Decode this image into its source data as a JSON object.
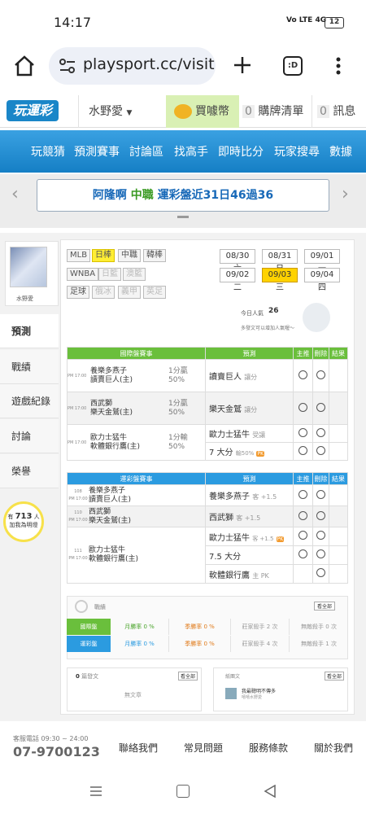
{
  "status": {
    "time": "14:17",
    "network": "Vo LTE 4G",
    "battery": "12"
  },
  "browser": {
    "url": "playsport.cc/visit",
    "tab_count": ":D"
  },
  "header": {
    "logo": "玩運彩",
    "user": "水野愛",
    "coins": "買噱幣",
    "cart_count": "0",
    "cart": "購牌清單",
    "msg_count": "0",
    "msg": "訊息"
  },
  "nav": [
    "玩競猜",
    "預測賽事",
    "討論區",
    "找高手",
    "即時比分",
    "玩家搜尋",
    "數據"
  ],
  "banner": {
    "name": "阿隆啊",
    "league": "中職",
    "text": "運彩盤近31日46過36"
  },
  "sidebar": {
    "username": "水野愛",
    "items": [
      "預測",
      "戰績",
      "遊戲紀錄",
      "討論",
      "榮譽"
    ],
    "lightbulb": {
      "prefix": "有",
      "count": "713",
      "suffix": "人",
      "caption": "加我為明燈"
    }
  },
  "leagues": {
    "row1": [
      "MLB",
      "日棒",
      "中職",
      "韓棒"
    ],
    "row2": [
      "WNBA",
      "日籃",
      "澳籃"
    ],
    "row3": [
      "足球",
      "俄冰",
      "義甲",
      "英足"
    ]
  },
  "dates": [
    "08/30 六",
    "08/31 日",
    "09/01 一",
    "09/02 二",
    "09/03 三",
    "09/04 四"
  ],
  "popularity": {
    "label": "今日人氣",
    "value": "26",
    "note": "多發文可以增加人氣喔～"
  },
  "intl": {
    "headers": [
      "國際盤賽事",
      "預測",
      "主推",
      "刪除",
      "結果"
    ],
    "rows": [
      {
        "time": "PM 17:00",
        "team1": "養樂多燕子",
        "team2": "讀賣巨人(主)",
        "line1": "1分贏",
        "line2": "50%",
        "picks": [
          {
            "name": "讀賣巨人",
            "tag": "讓分"
          }
        ]
      },
      {
        "time": "PM 17:00",
        "team1": "西武獅",
        "team2": "樂天金鷲(主)",
        "line1": "1分贏",
        "line2": "50%",
        "picks": [
          {
            "name": "樂天金鷲",
            "tag": "讓分"
          }
        ]
      },
      {
        "time": "PM 17:00",
        "team1": "歐力士猛牛",
        "team2": "軟體銀行鷹(主)",
        "line1": "1分輸",
        "line2": "50%",
        "picks": [
          {
            "name": "歐力士猛牛",
            "tag": "受讓"
          },
          {
            "name": "7 大分",
            "tag": "輸50%"
          }
        ]
      }
    ]
  },
  "local": {
    "headers": [
      "運彩盤賽事",
      "預測",
      "主推",
      "刪除",
      "結果"
    ],
    "rows": [
      {
        "num": "108",
        "time": "PM 17:00",
        "team1": "養樂多燕子",
        "team2": "讀賣巨人(主)",
        "picks": [
          {
            "name": "養樂多燕子",
            "tag": "客 +1.5"
          }
        ]
      },
      {
        "num": "110",
        "time": "PM 17:00",
        "team1": "西武獅",
        "team2": "樂天金鷲(主)",
        "picks": [
          {
            "name": "西武獅",
            "tag": "客 +1.5"
          }
        ]
      },
      {
        "num": "111",
        "time": "PM 17:00",
        "team1": "歐力士猛牛",
        "team2": "軟體銀行鷹(主)",
        "picks": [
          {
            "name": "歐力士猛牛",
            "tag": "客 +1.5"
          },
          {
            "name": "7.5 大分",
            "tag": ""
          },
          {
            "name": "軟體銀行鷹",
            "tag": "主 PK"
          }
        ]
      }
    ]
  },
  "record": {
    "title": "戰績",
    "more": "看全部",
    "rows": [
      {
        "label": "國際盤",
        "a": "月勝率 0 %",
        "b": "季勝率 0 %",
        "c": "莊家殺手 2 次",
        "d": "無敵殺手 0 次"
      },
      {
        "label": "運彩盤",
        "a": "月勝率 0 %",
        "b": "季勝率 0 %",
        "c": "莊家殺手 4 次",
        "d": "無敵殺手 1 次"
      }
    ]
  },
  "posts": {
    "left_count": "0",
    "left_title": "篇發文",
    "left_more": "看全部",
    "left_empty": "無文章",
    "right_title": "紙團文",
    "right_more": "看全部",
    "right_post": "我最聰明不傳多",
    "right_sub": "嘻嘻水野愛"
  },
  "footer": {
    "hotline_label": "客服電話 09:30 ~ 24:00",
    "phone": "07-9700123",
    "links": [
      "聯絡我們",
      "常見問題",
      "服務條款",
      "關於我們"
    ]
  },
  "colors": {
    "brand": "#1a86c8",
    "intl": "#6abf3c",
    "local": "#2b9be0",
    "highlight": "#ffd200"
  }
}
